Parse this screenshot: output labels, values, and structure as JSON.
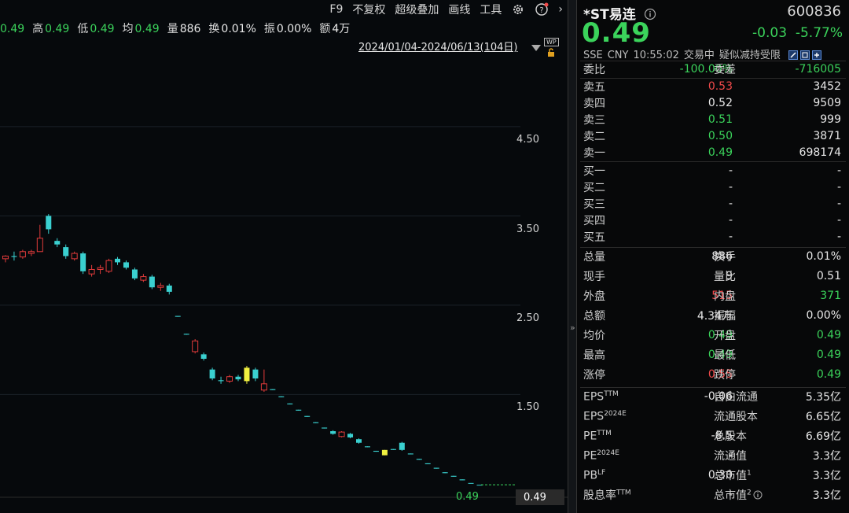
{
  "toolbar": {
    "f9": "F9",
    "adjust": "不复权",
    "overlay": "超级叠加",
    "draw": "画线",
    "tools": "工具",
    "more": "›"
  },
  "stats": [
    {
      "k": "",
      "v": "0.49",
      "cls": "green"
    },
    {
      "k": "高",
      "v": "0.49",
      "cls": "green"
    },
    {
      "k": "低",
      "v": "0.49",
      "cls": "green"
    },
    {
      "k": "均",
      "v": "0.49",
      "cls": "green"
    },
    {
      "k": "量",
      "v": "886",
      "cls": "white"
    },
    {
      "k": "换",
      "v": "0.01%",
      "cls": "white"
    },
    {
      "k": "振",
      "v": "0.00%",
      "cls": "white"
    },
    {
      "k": "额",
      "v": "4万",
      "cls": "white"
    }
  ],
  "date_range": "2024/01/04-2024/06/13(104日)",
  "wp_badge": "WP",
  "y_axis": [
    "4.50",
    "3.50",
    "2.50",
    "1.50"
  ],
  "last_price_line": "0.49",
  "last_price_tag": "0.49",
  "chart_data": {
    "type": "candlestick",
    "yrange": [
      0.35,
      5.3
    ],
    "ticks": [
      4.5,
      3.5,
      2.5,
      1.5
    ],
    "candles": [
      [
        3.05,
        3.08,
        3.02,
        3.0
      ],
      [
        3.02,
        3.05,
        3.06,
        2.98
      ],
      [
        3.05,
        3.04,
        3.1,
        3.0
      ],
      [
        3.04,
        3.1,
        3.12,
        3.02
      ],
      [
        3.08,
        3.1,
        3.12,
        3.05
      ],
      [
        3.1,
        3.25,
        3.4,
        3.1
      ],
      [
        3.5,
        3.35,
        3.52,
        3.3
      ],
      [
        3.22,
        3.18,
        3.25,
        3.15
      ],
      [
        3.15,
        3.05,
        3.18,
        3.02
      ],
      [
        3.02,
        3.08,
        3.1,
        3.0
      ],
      [
        3.08,
        2.88,
        3.1,
        2.85
      ],
      [
        2.85,
        2.9,
        2.95,
        2.82
      ],
      [
        2.9,
        2.92,
        2.95,
        2.85
      ],
      [
        2.88,
        3.0,
        3.02,
        2.86
      ],
      [
        3.02,
        2.98,
        3.04,
        2.95
      ],
      [
        2.98,
        2.92,
        3.0,
        2.9
      ],
      [
        2.9,
        2.8,
        2.92,
        2.78
      ],
      [
        2.78,
        2.82,
        2.85,
        2.76
      ],
      [
        2.82,
        2.7,
        2.84,
        2.68
      ],
      [
        2.7,
        2.72,
        2.75,
        2.66
      ],
      [
        2.72,
        2.65,
        2.74,
        2.62
      ],
      [
        2.38,
        2.37,
        2.38,
        2.37
      ],
      [
        2.18,
        2.17,
        2.18,
        2.17
      ],
      [
        1.98,
        2.1,
        2.12,
        1.96
      ],
      [
        1.95,
        1.9,
        1.97,
        1.88
      ],
      [
        1.78,
        1.68,
        1.8,
        1.66
      ],
      [
        1.66,
        1.65,
        1.7,
        1.62
      ],
      [
        1.65,
        1.7,
        1.72,
        1.63
      ],
      [
        1.7,
        1.67,
        1.72,
        1.65
      ],
      [
        1.8,
        1.65,
        1.82,
        1.62
      ],
      [
        1.78,
        1.68,
        1.8,
        1.65
      ],
      [
        1.55,
        1.62,
        1.78,
        1.53
      ],
      [
        1.56,
        1.55,
        1.56,
        1.55
      ],
      [
        1.48,
        1.47,
        1.48,
        1.47
      ],
      [
        1.4,
        1.39,
        1.4,
        1.39
      ],
      [
        1.33,
        1.32,
        1.33,
        1.32
      ],
      [
        1.26,
        1.25,
        1.26,
        1.25
      ],
      [
        1.19,
        1.18,
        1.19,
        1.18
      ],
      [
        1.13,
        1.12,
        1.13,
        1.12
      ],
      [
        1.09,
        1.06,
        1.1,
        1.05
      ],
      [
        1.03,
        1.08,
        1.09,
        1.02
      ],
      [
        1.06,
        1.02,
        1.07,
        1.01
      ],
      [
        1.0,
        0.96,
        1.01,
        0.95
      ],
      [
        0.92,
        0.91,
        0.92,
        0.91
      ],
      [
        0.87,
        0.86,
        0.87,
        0.86
      ],
      [
        0.88,
        0.82,
        0.88,
        0.82
      ],
      [
        0.89,
        0.88,
        0.89,
        0.88
      ],
      [
        0.96,
        0.88,
        0.97,
        0.87
      ],
      [
        0.84,
        0.83,
        0.84,
        0.83
      ],
      [
        0.78,
        0.77,
        0.78,
        0.77
      ],
      [
        0.73,
        0.72,
        0.73,
        0.72
      ],
      [
        0.68,
        0.67,
        0.68,
        0.67
      ],
      [
        0.63,
        0.62,
        0.63,
        0.62
      ],
      [
        0.59,
        0.58,
        0.59,
        0.58
      ],
      [
        0.55,
        0.54,
        0.55,
        0.54
      ],
      [
        0.51,
        0.51,
        0.51,
        0.51
      ],
      [
        0.49,
        0.49,
        0.49,
        0.49
      ]
    ],
    "yellow_indices": [
      29,
      45
    ],
    "last": 0.49
  },
  "quote": {
    "name": "*ST易连",
    "code": "600836",
    "price": "0.49",
    "change": "-0.03",
    "change_pct": "-5.77%",
    "exchange": "SSE",
    "currency": "CNY",
    "time": "10:55:02",
    "status": "交易中",
    "note": "疑似减持受限",
    "weibi_label": "委比",
    "weibi": "-100.00%",
    "weicha_label": "委差",
    "weicha": "-716005",
    "asks": [
      {
        "label": "卖五",
        "price": "0.53",
        "cls": "red",
        "vol": "3452"
      },
      {
        "label": "卖四",
        "price": "0.52",
        "cls": "white",
        "vol": "9509"
      },
      {
        "label": "卖三",
        "price": "0.51",
        "cls": "green",
        "vol": "999"
      },
      {
        "label": "卖二",
        "price": "0.50",
        "cls": "green",
        "vol": "3871"
      },
      {
        "label": "卖一",
        "price": "0.49",
        "cls": "green",
        "vol": "698174"
      }
    ],
    "bids": [
      {
        "label": "买一",
        "price": "-",
        "vol": "-"
      },
      {
        "label": "买二",
        "price": "-",
        "vol": "-"
      },
      {
        "label": "买三",
        "price": "-",
        "vol": "-"
      },
      {
        "label": "买四",
        "price": "-",
        "vol": "-"
      },
      {
        "label": "买五",
        "price": "-",
        "vol": "-"
      }
    ],
    "stats": [
      {
        "l1": "总量",
        "v1": "886",
        "c1": "white",
        "l2": "换手",
        "v2": "0.01%",
        "c2": "white"
      },
      {
        "l1": "现手",
        "v1": "9",
        "c1": "white",
        "l2": "量比",
        "v2": "0.51",
        "c2": "white"
      },
      {
        "l1": "外盘",
        "v1": "515",
        "c1": "red",
        "l2": "内盘",
        "v2": "371",
        "c2": "green"
      },
      {
        "l1": "总额",
        "v1": "4.34万",
        "c1": "white",
        "l2": "振幅",
        "v2": "0.00%",
        "c2": "white"
      },
      {
        "l1": "均价",
        "v1": "0.49",
        "c1": "green",
        "l2": "开盘",
        "v2": "0.49",
        "c2": "green"
      },
      {
        "l1": "最高",
        "v1": "0.49",
        "c1": "green",
        "l2": "最低",
        "v2": "0.49",
        "c2": "green"
      },
      {
        "l1": "涨停",
        "v1": "0.55",
        "c1": "red",
        "l2": "跌停",
        "v2": "0.49",
        "c2": "green"
      }
    ],
    "fund": [
      {
        "l1": "EPS",
        "s1": "TTM",
        "v1": "-0.06",
        "l2": "自由流通",
        "s2": "",
        "v2": "5.35亿"
      },
      {
        "l1": "EPS",
        "s1": "2024E",
        "v1": "",
        "l2": "流通股本",
        "s2": "",
        "v2": "6.65亿"
      },
      {
        "l1": "PE",
        "s1": "TTM",
        "v1": "-8.5",
        "l2": "总股本",
        "s2": "",
        "v2": "6.69亿"
      },
      {
        "l1": "PE",
        "s1": "2024E",
        "v1": "-",
        "l2": "流通值",
        "s2": "",
        "v2": "3.3亿"
      },
      {
        "l1": "PB",
        "s1": "LF",
        "v1": "0.30",
        "l2": "总市值",
        "s2": "1",
        "v2": "3.3亿"
      },
      {
        "l1": "股息率",
        "s1": "TTM",
        "v1": "-",
        "l2": "总市值",
        "s2": "2",
        "v2": "3.3亿"
      }
    ]
  }
}
